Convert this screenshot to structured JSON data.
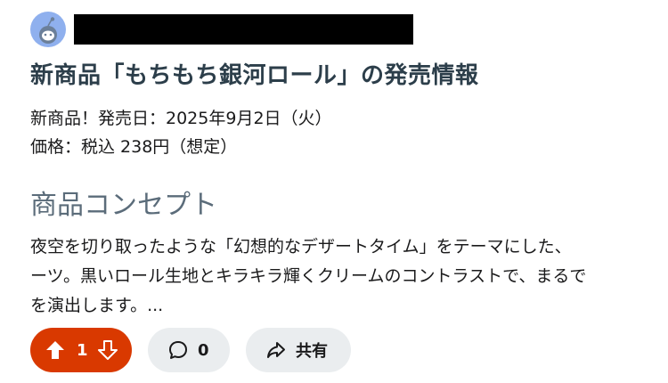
{
  "post": {
    "title": "新商品「もちもち銀河ロール」の発売情報",
    "meta_line1": "新商品！発売日：2025年9月2日（火）",
    "meta_line2": "価格：税込 238円（想定）",
    "section_heading": "商品コンセプト",
    "body_line1": "夜空を切り取ったような「幻想的なデザートタイム」をテーマにした、",
    "body_line2": "ーツ。黒いロール生地とキラキラ輝くクリームのコントラストで、まるで",
    "body_line3": "を演出します。..."
  },
  "actions": {
    "vote_count": "1",
    "comment_count": "0",
    "share_label": "共有"
  },
  "colors": {
    "vote_background": "#d93900",
    "pill_background": "#eaedef",
    "avatar_background": "#8fb0ee",
    "title_color": "#2c3e4a",
    "heading_color": "#5b6c7a"
  },
  "icons": {
    "avatar": "snoo-avatar-icon",
    "upvote": "arrow-up-icon",
    "downvote": "arrow-down-icon",
    "comment": "comment-bubble-icon",
    "share": "share-arrow-icon"
  }
}
